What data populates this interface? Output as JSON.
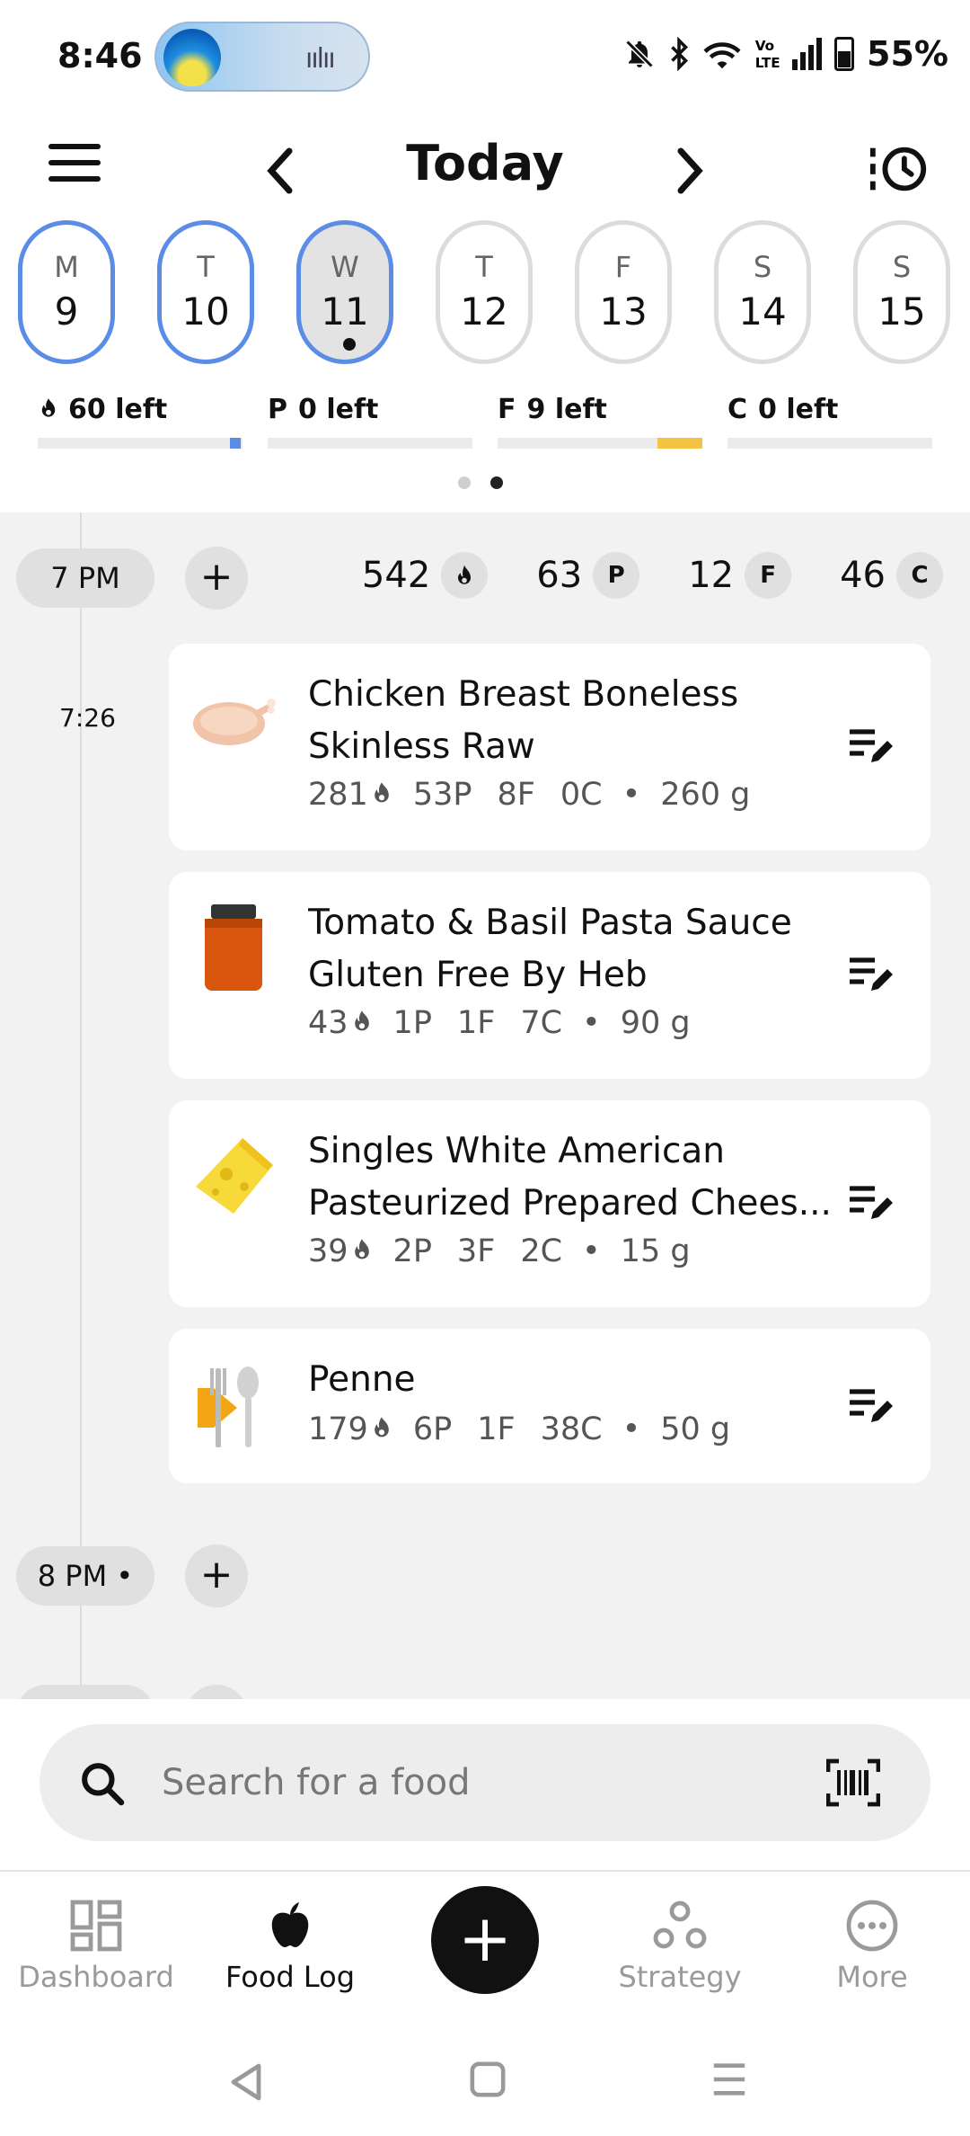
{
  "status_bar": {
    "time": "8:46",
    "battery": "55%",
    "icons": [
      "media-pill",
      "bell-off-icon",
      "bluetooth-icon",
      "wifi-icon",
      "volte-icon",
      "signal-icon",
      "battery-icon"
    ]
  },
  "header": {
    "title": "Today",
    "prev_icon": "chevron-left-icon",
    "next_icon": "chevron-right-icon",
    "menu_icon": "hamburger-icon",
    "history_icon": "history-icon"
  },
  "week": [
    {
      "letter": "M",
      "num": "9",
      "ring": true,
      "selected": false
    },
    {
      "letter": "T",
      "num": "10",
      "ring": true,
      "selected": false
    },
    {
      "letter": "W",
      "num": "11",
      "ring": true,
      "selected": true
    },
    {
      "letter": "T",
      "num": "12",
      "ring": false,
      "selected": false
    },
    {
      "letter": "F",
      "num": "13",
      "ring": false,
      "selected": false
    },
    {
      "letter": "S",
      "num": "14",
      "ring": false,
      "selected": false
    },
    {
      "letter": "S",
      "num": "15",
      "ring": false,
      "selected": false
    }
  ],
  "macros_left": [
    {
      "prefix": "flame",
      "text": "60 left",
      "progress": 0.95,
      "color": "#5b8ce6"
    },
    {
      "prefix": "P",
      "text": "0 left",
      "progress": 1.0,
      "color": "#ebebeb"
    },
    {
      "prefix": "F",
      "text": "9 left",
      "progress": 0.78,
      "color": "#f5c342"
    },
    {
      "prefix": "C",
      "text": "0 left",
      "progress": 1.0,
      "color": "#ebebeb"
    }
  ],
  "log": {
    "meal_7pm": {
      "hour": "7 PM",
      "totals": {
        "calories": "542",
        "protein": "63",
        "fat": "12",
        "carbs": "46"
      },
      "chips": {
        "p": "P",
        "f": "F",
        "c": "C"
      },
      "time_stamp": "7:26",
      "items": [
        {
          "name1": "Chicken Breast Boneless",
          "name2": "Skinless Raw",
          "cal": "281",
          "p": "53P",
          "f": "8F",
          "c": "0C",
          "amount": "260 g",
          "icon": "chicken-icon"
        },
        {
          "name1": "Tomato & Basil Pasta Sauce",
          "name2": "Gluten Free By Heb",
          "cal": "43",
          "p": "1P",
          "f": "1F",
          "c": "7C",
          "amount": "90 g",
          "icon": "sauce-jar-icon"
        },
        {
          "name1": "Singles White American",
          "name2": "Pasteurized Prepared Chees...",
          "cal": "39",
          "p": "2P",
          "f": "3F",
          "c": "2C",
          "amount": "15 g",
          "icon": "cheese-icon"
        },
        {
          "name1": "Penne",
          "name2": "",
          "cal": "179",
          "p": "6P",
          "f": "1F",
          "c": "38C",
          "amount": "50 g",
          "icon": "utensils-icon"
        }
      ]
    },
    "meal_8pm": {
      "hour": "8 PM"
    }
  },
  "search": {
    "placeholder": "Search for a food"
  },
  "tabs": {
    "dashboard": "Dashboard",
    "food_log": "Food Log",
    "add": "+",
    "strategy": "Strategy",
    "more": "More"
  },
  "bullet": "•"
}
